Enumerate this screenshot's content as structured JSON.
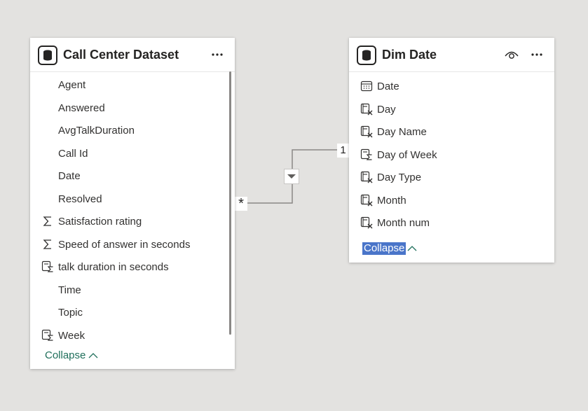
{
  "tables": [
    {
      "title": "Call Center Dataset",
      "fields": [
        {
          "label": "Agent",
          "icon": "none"
        },
        {
          "label": "Answered",
          "icon": "none"
        },
        {
          "label": "AvgTalkDuration",
          "icon": "none"
        },
        {
          "label": "Call Id",
          "icon": "none"
        },
        {
          "label": "Date",
          "icon": "none"
        },
        {
          "label": "Resolved",
          "icon": "none"
        },
        {
          "label": "Satisfaction rating",
          "icon": "sigma-icon"
        },
        {
          "label": "Speed of answer in seconds",
          "icon": "sigma-icon"
        },
        {
          "label": "talk duration in seconds",
          "icon": "calculated-measure-icon"
        },
        {
          "label": "Time",
          "icon": "none"
        },
        {
          "label": "Topic",
          "icon": "none"
        },
        {
          "label": "Week",
          "icon": "calculated-measure-icon"
        }
      ],
      "collapse_label": "Collapse"
    },
    {
      "title": "Dim Date",
      "fields": [
        {
          "label": "Date",
          "icon": "calendar-icon"
        },
        {
          "label": "Day",
          "icon": "calculated-column-icon"
        },
        {
          "label": "Day Name",
          "icon": "calculated-column-icon"
        },
        {
          "label": "Day of Week",
          "icon": "calculated-measure-icon"
        },
        {
          "label": "Day Type",
          "icon": "calculated-column-icon"
        },
        {
          "label": "Month",
          "icon": "calculated-column-icon"
        },
        {
          "label": "Month num",
          "icon": "calculated-column-icon"
        }
      ],
      "collapse_label": "Collapse"
    }
  ],
  "relationship": {
    "many_symbol": "*",
    "one_symbol": "1"
  },
  "colors": {
    "canvas": "#e3e2e0",
    "accent": "#1f6f5b",
    "selection": "#4a75c9"
  }
}
